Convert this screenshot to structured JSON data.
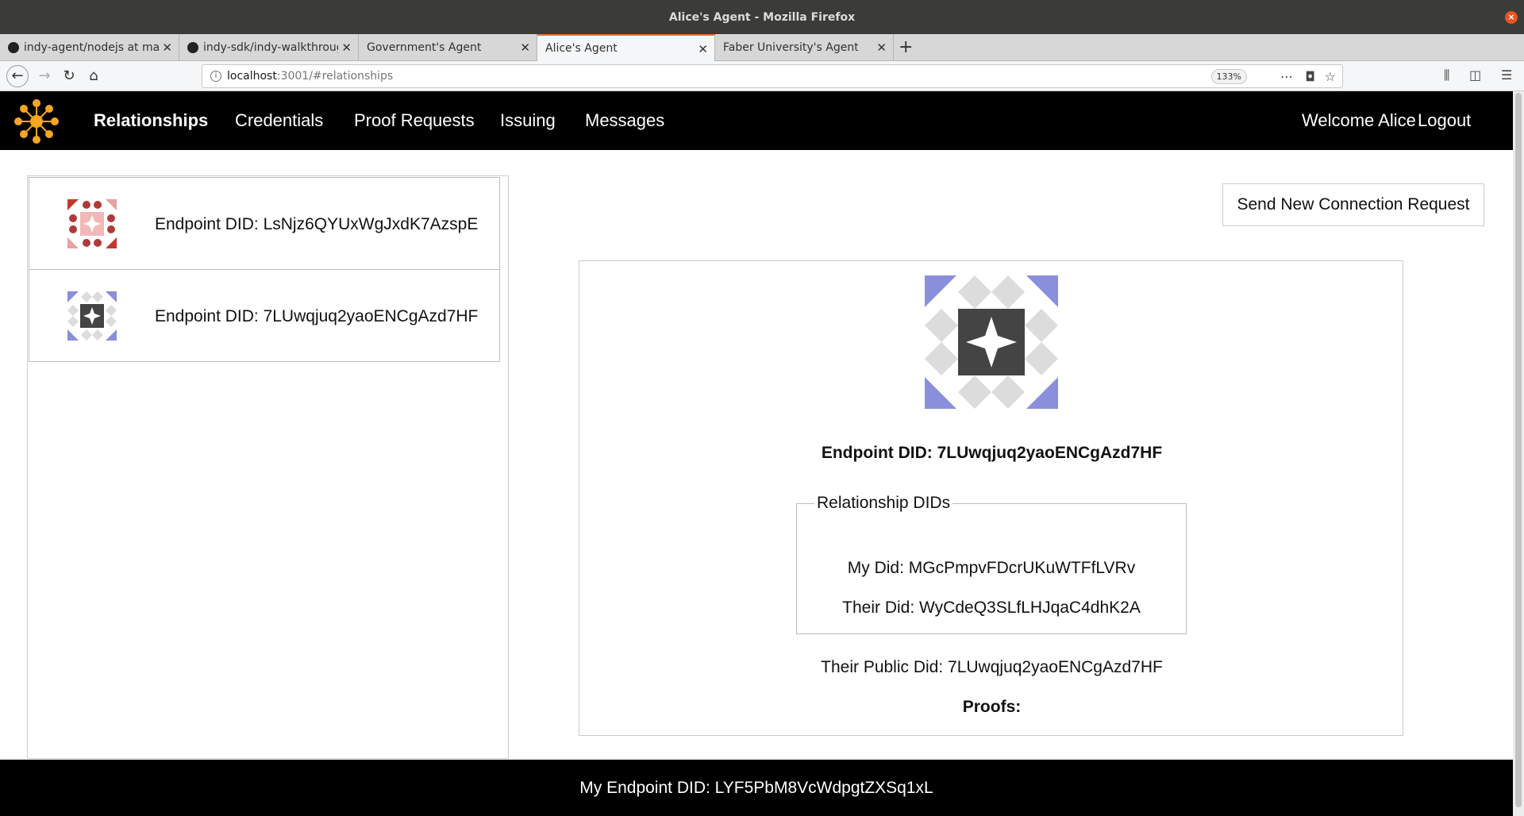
{
  "window": {
    "title": "Alice's Agent - Mozilla Firefox"
  },
  "tabs": [
    {
      "title": "indy-agent/nodejs at mas"
    },
    {
      "title": "indy-sdk/indy-walkthroug"
    },
    {
      "title": "Government's Agent"
    },
    {
      "title": "Alice's Agent"
    },
    {
      "title": "Faber University's Agent"
    }
  ],
  "address_bar": {
    "host": "localhost",
    "rest": ":3001/#relationships",
    "zoom": "133%"
  },
  "nav": {
    "items": [
      "Relationships",
      "Credentials",
      "Proof Requests",
      "Issuing",
      "Messages"
    ],
    "welcome": "Welcome Alice",
    "logout": "Logout"
  },
  "relationships": [
    {
      "label": "Endpoint DID: LsNjz6QYUxWgJxdK7AzspE",
      "icon": "identicon-red"
    },
    {
      "label": "Endpoint DID: 7LUwqjuq2yaoENCgAzd7HF",
      "icon": "identicon-blue"
    }
  ],
  "send_button": "Send New Connection Request",
  "detail": {
    "title": "Endpoint DID: 7LUwqjuq2yaoENCgAzd7HF",
    "legend": "Relationship DIDs",
    "my_did": "My Did: MGcPmpvFDcrUKuWTFfLVRv",
    "their_did": "Their Did: WyCdeQ3SLfLHJqaC4dhK2A",
    "their_public_did": "Their Public Did: 7LUwqjuq2yaoENCgAzd7HF",
    "proofs": "Proofs:"
  },
  "footer": "My Endpoint DID: LYF5PbM8VcWdpgtZXSq1xL",
  "colors": {
    "accent": "#f5a623",
    "nav_bg": "#000000",
    "ident_red": "#c0392b",
    "ident_blue": "#8a8fdc"
  }
}
